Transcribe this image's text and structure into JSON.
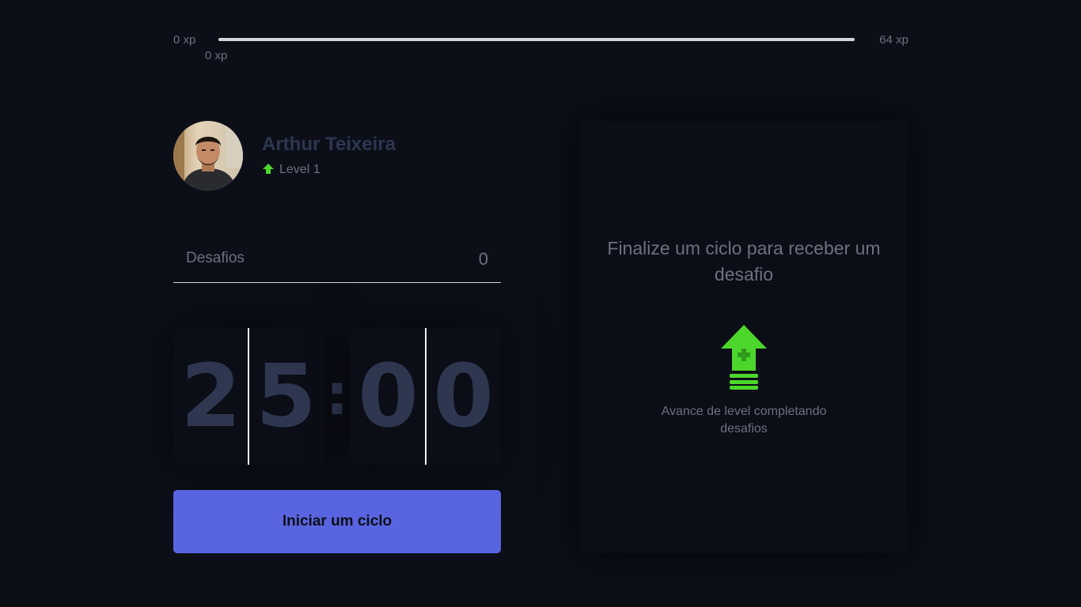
{
  "experience": {
    "min_label": "0 xp",
    "max_label": "64 xp",
    "current_label": "0 xp",
    "progress_fraction": 0
  },
  "profile": {
    "name": "Arthur Teixeira",
    "level_label": "Level 1",
    "level_icon": "level-arrow-icon",
    "avatar": "user-photo"
  },
  "challenges": {
    "label": "Desafios",
    "count": "0"
  },
  "countdown": {
    "minute_left": "2",
    "minute_right": "5",
    "separator": ":",
    "second_left": "0",
    "second_right": "0"
  },
  "start_button": {
    "label": "Iniciar um ciclo"
  },
  "challenge_box": {
    "title": "Finalize um ciclo para receber um desafio",
    "icon": "level-up-icon",
    "hint": "Avance de level completando desafios"
  },
  "colors": {
    "background": "#0c0f18",
    "accent": "#5965e0",
    "green": "#4cd62b",
    "muted_text": "#6b7180",
    "title_text": "#2e3650"
  }
}
